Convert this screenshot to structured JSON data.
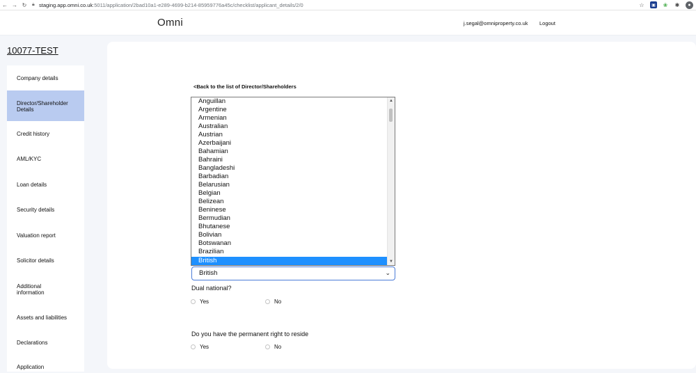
{
  "browser": {
    "url_host": "staging.app.omni.co.uk",
    "url_path": ":5011/application/2bad10a1-e289-4699-b214-85959776a45c/checklist/applicant_details/2/0"
  },
  "header": {
    "brand": "Omni",
    "user_email": "j.segal@omniproperty.co.uk",
    "logout_label": "Logout"
  },
  "application_ref": "10077-TEST",
  "sidebar": {
    "items": [
      {
        "label": "Company details"
      },
      {
        "label": "Director/Shareholder Details",
        "active": true
      },
      {
        "label": "Credit history"
      },
      {
        "label": "AML/KYC"
      },
      {
        "label": "Loan details"
      },
      {
        "label": "Security details"
      },
      {
        "label": "Valuation report"
      },
      {
        "label": "Solicitor details"
      },
      {
        "label": "Additional information"
      },
      {
        "label": "Assets and liabilities"
      },
      {
        "label": "Declarations"
      },
      {
        "label": "Application"
      }
    ]
  },
  "main": {
    "back_link": "<Back to the list of Director/Shareholders",
    "nationality": {
      "selected": "British",
      "options": [
        "Anguillan",
        "Argentine",
        "Armenian",
        "Australian",
        "Austrian",
        "Azerbaijani",
        "Bahamian",
        "Bahraini",
        "Bangladeshi",
        "Barbadian",
        "Belarusian",
        "Belgian",
        "Belizean",
        "Beninese",
        "Bermudian",
        "Bhutanese",
        "Bolivian",
        "Botswanan",
        "Brazilian",
        "British"
      ]
    },
    "dual_national": {
      "question": "Dual national?",
      "yes": "Yes",
      "no": "No"
    },
    "right_to_reside": {
      "question": "Do you have the permanent right to reside",
      "yes": "Yes",
      "no": "No"
    }
  },
  "icons": {
    "back": "arrow-left-icon",
    "forward": "arrow-right-icon",
    "reload": "reload-icon",
    "lock": "lock-icon",
    "star": "star-icon",
    "extensions": "puzzle-icon",
    "profile": "profile-icon"
  }
}
